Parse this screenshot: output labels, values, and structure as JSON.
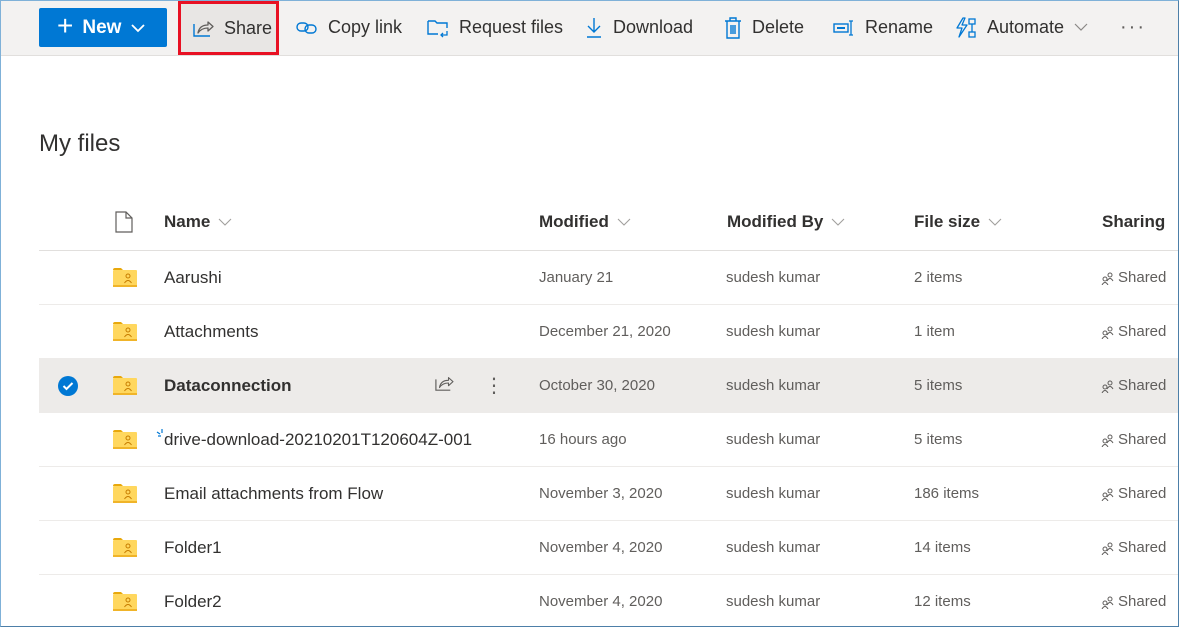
{
  "toolbar": {
    "new_label": "New",
    "share_label": "Share",
    "copy_link_label": "Copy link",
    "request_files_label": "Request files",
    "download_label": "Download",
    "delete_label": "Delete",
    "rename_label": "Rename",
    "automate_label": "Automate",
    "more_label": "···"
  },
  "page": {
    "title": "My files"
  },
  "table": {
    "columns": {
      "name": "Name",
      "modified": "Modified",
      "modified_by": "Modified By",
      "file_size": "File size",
      "sharing": "Sharing"
    },
    "rows": [
      {
        "name": "Aarushi",
        "modified": "January 21",
        "modified_by": "sudesh kumar",
        "file_size": "2 items",
        "sharing": "Shared"
      },
      {
        "name": "Attachments",
        "modified": "December 21, 2020",
        "modified_by": "sudesh kumar",
        "file_size": "1 item",
        "sharing": "Shared"
      },
      {
        "name": "Dataconnection",
        "modified": "October 30, 2020",
        "modified_by": "sudesh kumar",
        "file_size": "5 items",
        "sharing": "Shared",
        "selected": true
      },
      {
        "name": "drive-download-20210201T120604Z-001",
        "modified": "16 hours ago",
        "modified_by": "sudesh kumar",
        "file_size": "5 items",
        "sharing": "Shared",
        "new": true
      },
      {
        "name": "Email attachments from Flow",
        "modified": "November 3, 2020",
        "modified_by": "sudesh kumar",
        "file_size": "186 items",
        "sharing": "Shared"
      },
      {
        "name": "Folder1",
        "modified": "November 4, 2020",
        "modified_by": "sudesh kumar",
        "file_size": "14 items",
        "sharing": "Shared"
      },
      {
        "name": "Folder2",
        "modified": "November 4, 2020",
        "modified_by": "sudesh kumar",
        "file_size": "12 items",
        "sharing": "Shared"
      }
    ]
  },
  "colors": {
    "accent": "#0078d4",
    "highlight_border": "#e81123",
    "folder": "#ffd75e",
    "selected_row": "#edebe9"
  }
}
